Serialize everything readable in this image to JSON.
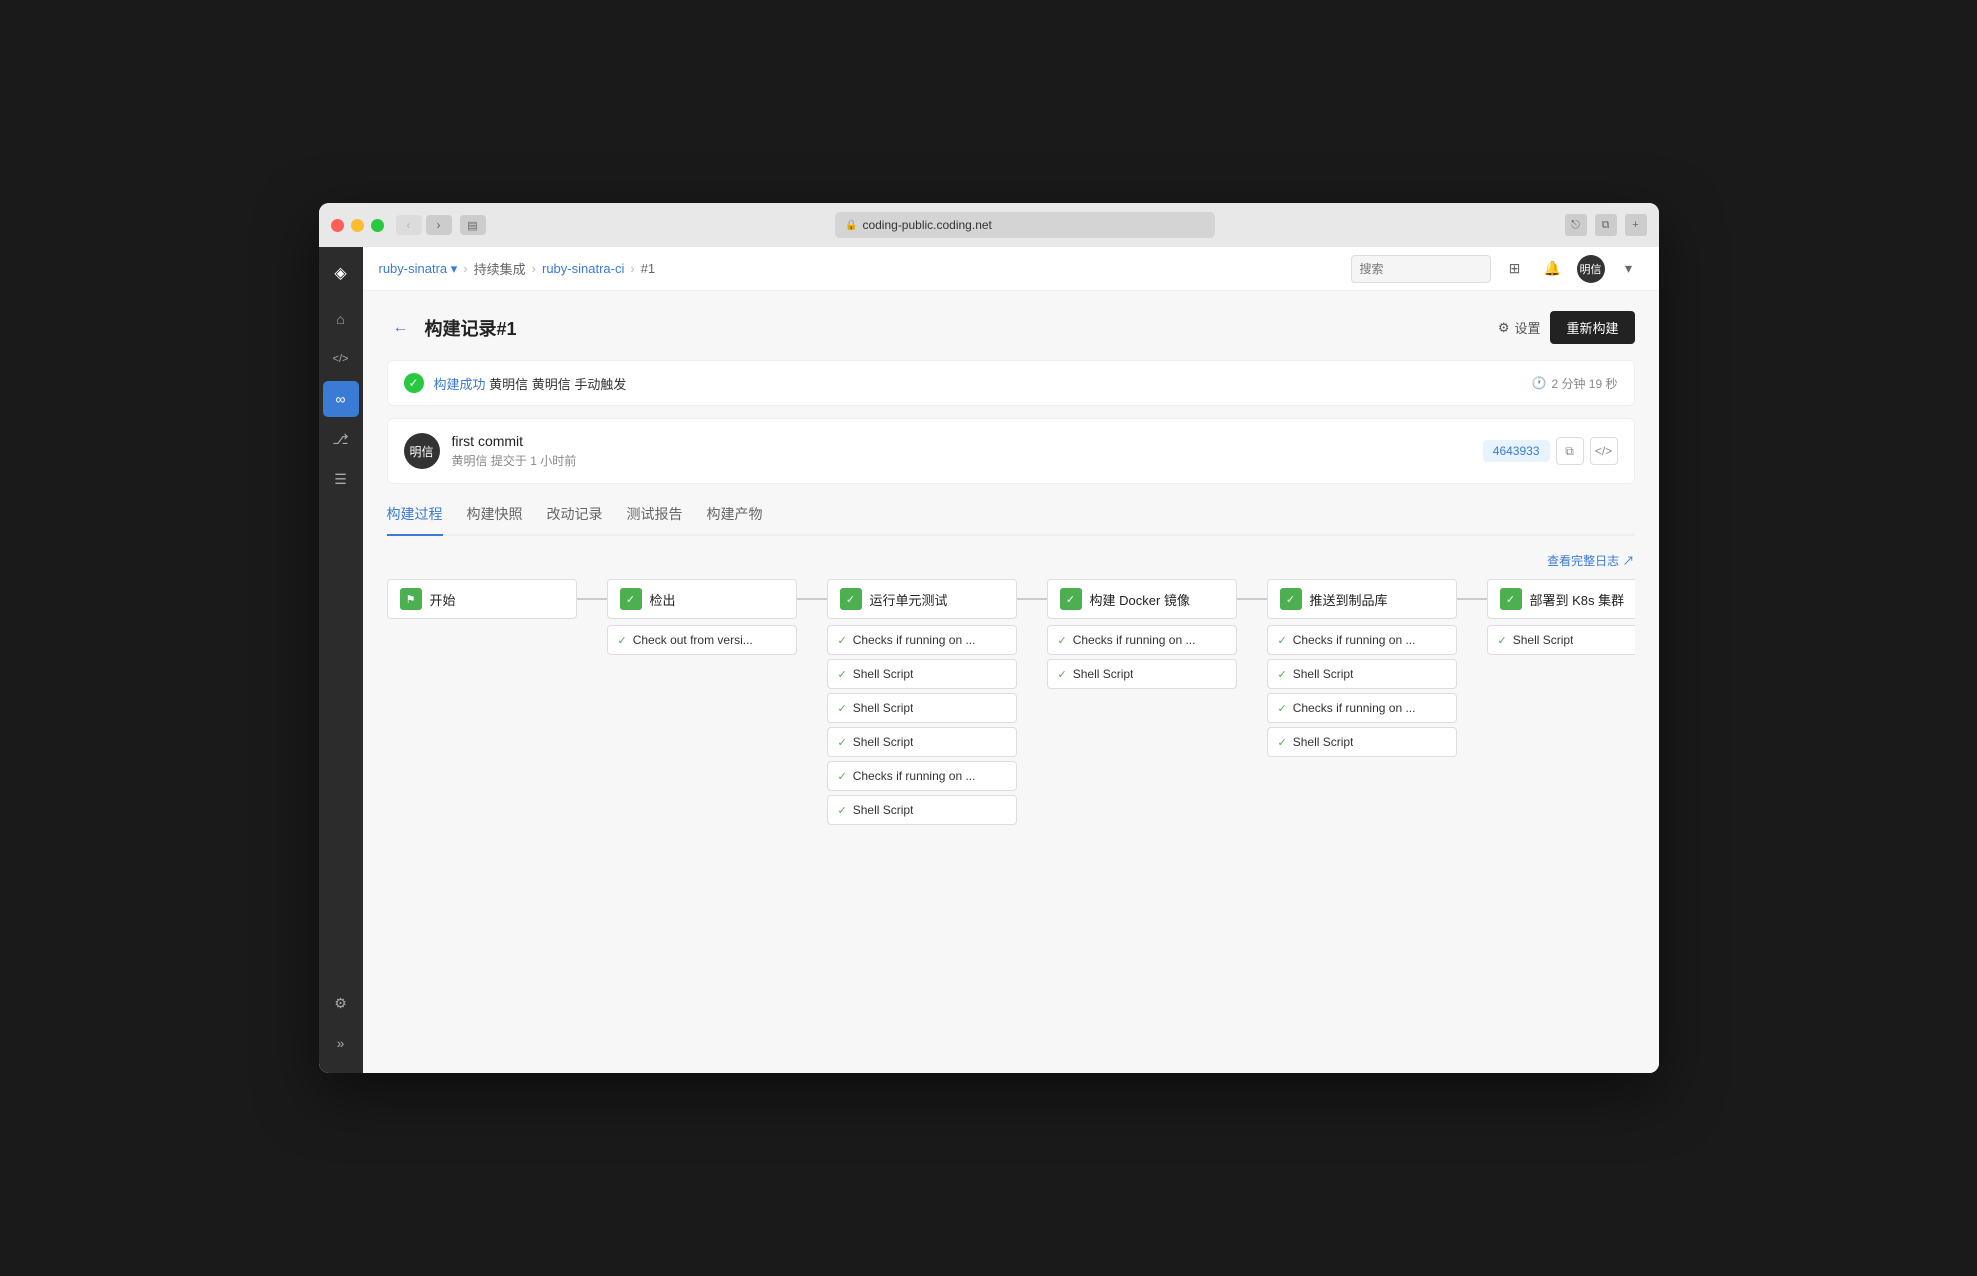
{
  "window": {
    "title": "coding-public.coding.net",
    "traffic_lights": [
      "red",
      "yellow",
      "green"
    ]
  },
  "titlebar": {
    "url": "coding-public.coding.net"
  },
  "breadcrumb": {
    "items": [
      "ruby-sinatra",
      "持续集成",
      "ruby-sinatra-ci",
      "#1"
    ]
  },
  "search": {
    "placeholder": "搜索"
  },
  "topnav": {
    "avatar_label": "明信"
  },
  "page": {
    "title": "构建记录#1",
    "settings_label": "设置",
    "rebuild_label": "重新构建"
  },
  "status": {
    "icon": "✓",
    "text": "构建成功",
    "author": "黄明信",
    "trigger": "手动触发",
    "time": "2 分钟 19 秒"
  },
  "commit": {
    "avatar": "明信",
    "title": "first commit",
    "author": "黄明信",
    "sub": "提交于 1 小时前",
    "hash": "4643933"
  },
  "tabs": [
    {
      "label": "构建过程",
      "active": true
    },
    {
      "label": "构建快照",
      "active": false
    },
    {
      "label": "改动记录",
      "active": false
    },
    {
      "label": "测试报告",
      "active": false
    },
    {
      "label": "构建产物",
      "active": false
    }
  ],
  "pipeline": {
    "log_link": "查看完整日志 ↗",
    "stages": [
      {
        "id": "start",
        "title": "开始",
        "type": "start",
        "steps": []
      },
      {
        "id": "checkout",
        "title": "检出",
        "type": "success",
        "steps": [
          {
            "label": "Check out from versi..."
          }
        ]
      },
      {
        "id": "unit-test",
        "title": "运行单元测试",
        "type": "success",
        "steps": [
          {
            "label": "Checks if running on ..."
          },
          {
            "label": "Shell Script"
          },
          {
            "label": "Shell Script"
          },
          {
            "label": "Shell Script"
          },
          {
            "label": "Checks if running on ..."
          },
          {
            "label": "Shell Script"
          }
        ]
      },
      {
        "id": "docker",
        "title": "构建 Docker 镜像",
        "type": "success",
        "steps": [
          {
            "label": "Checks if running on ..."
          },
          {
            "label": "Shell Script"
          }
        ]
      },
      {
        "id": "push",
        "title": "推送到制品库",
        "type": "success",
        "steps": [
          {
            "label": "Checks if running on ..."
          },
          {
            "label": "Shell Script"
          },
          {
            "label": "Checks if running on ..."
          },
          {
            "label": "Shell Script"
          }
        ]
      },
      {
        "id": "deploy",
        "title": "部署到 K8s 集群",
        "type": "success",
        "steps": [
          {
            "label": "Shell Script"
          }
        ]
      }
    ]
  },
  "sidebar": {
    "icons": [
      {
        "name": "home",
        "symbol": "⌂",
        "active": false
      },
      {
        "name": "code",
        "symbol": "</>",
        "active": false
      },
      {
        "name": "ci",
        "symbol": "∞",
        "active": true
      },
      {
        "name": "deploy",
        "symbol": "⎇",
        "active": false
      },
      {
        "name": "docs",
        "symbol": "☰",
        "active": false
      }
    ],
    "bottom_icons": [
      {
        "name": "settings",
        "symbol": "⚙"
      },
      {
        "name": "expand",
        "symbol": "»"
      }
    ]
  }
}
